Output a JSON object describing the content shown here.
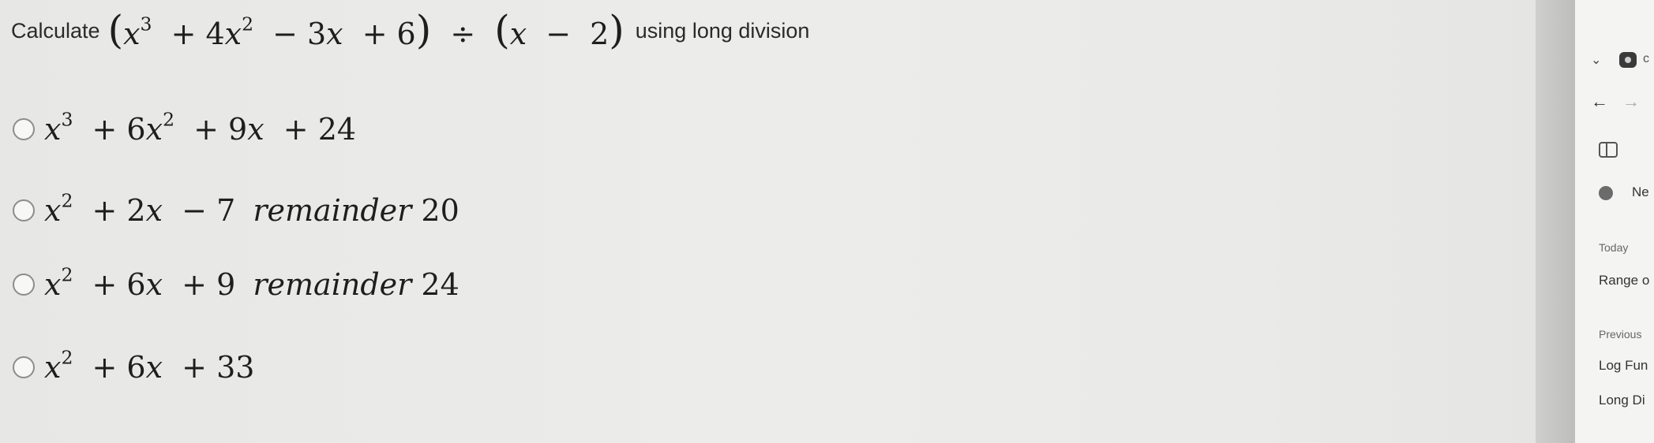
{
  "question": {
    "prefix": "Calculate",
    "suffix": "using long division",
    "dividend": {
      "x": "x",
      "exp3": "3",
      "plus1": "+",
      "coef2": "4",
      "x2": "x",
      "exp2": "2",
      "minus": "−",
      "coef1": "3",
      "x1": "x",
      "plus2": "+",
      "const": "6"
    },
    "divide_symbol": "÷",
    "divisor": {
      "x": "x",
      "minus": "−",
      "const": "2"
    }
  },
  "options": [
    {
      "terms": [
        "x",
        "3",
        "+ 6",
        "x",
        "2",
        "+ 9",
        "x",
        "+ 24"
      ],
      "remainder_word": "",
      "remainder_value": ""
    },
    {
      "terms": [
        "x",
        "2",
        "+ 2",
        "x",
        "",
        "− 7",
        "",
        ""
      ],
      "remainder_word": "remainder",
      "remainder_value": "20"
    },
    {
      "terms": [
        "x",
        "2",
        "+ 6",
        "x",
        "",
        "+ 9",
        "",
        ""
      ],
      "remainder_word": "remainder",
      "remainder_value": "24"
    },
    {
      "terms": [
        "x",
        "2",
        "+ 6",
        "x",
        "",
        "+ 33",
        "",
        ""
      ],
      "remainder_word": "",
      "remainder_value": ""
    }
  ],
  "side_panel": {
    "chevron": "⌄",
    "cut_letter": "c",
    "back_arrow": "←",
    "forward_arrow": "→",
    "new_label": "Ne",
    "today_label": "Today",
    "today_items": [
      "Range o"
    ],
    "previous_label": "Previous",
    "previous_items": [
      "Log Fun",
      "Long Di"
    ]
  }
}
